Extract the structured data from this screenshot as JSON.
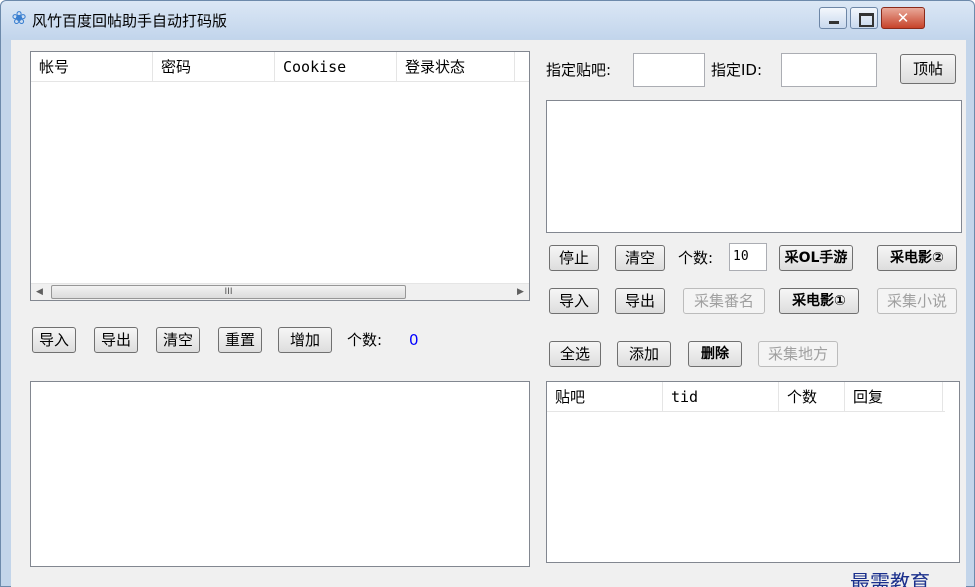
{
  "window": {
    "title": "风竹百度回帖助手自动打码版",
    "icon": "paw-icon",
    "controls": [
      "minimize-icon",
      "maximize-icon",
      "close-icon"
    ]
  },
  "accounts": {
    "columns": [
      "帐号",
      "密码",
      "Cookise",
      "登录状态"
    ],
    "rows": [],
    "scroll_grip": "III",
    "buttons": [
      "导入",
      "导出",
      "清空",
      "重置",
      "增加"
    ],
    "count_label": "个数:",
    "count_value": "0"
  },
  "target": {
    "bar_label": "指定贴吧:",
    "bar_value": "",
    "id_label": "指定ID:",
    "id_value": "",
    "top_button": "顶帖"
  },
  "collect": {
    "row1": {
      "stop": "停止",
      "clear": "清空",
      "count_label": "个数:",
      "count_value": "10",
      "game": "采OL手游",
      "movie2": "采电影②"
    },
    "row2": {
      "import": "导入",
      "export": "导出",
      "drama": "采集番名",
      "movie1": "采电影①",
      "novel": "采集小说"
    },
    "row3": {
      "select_all": "全选",
      "add": "添加",
      "delete": "删除",
      "place": "采集地方"
    },
    "disabled": [
      "采集番名",
      "采集小说",
      "采集地方"
    ]
  },
  "posts": {
    "columns": [
      "贴吧",
      "tid",
      "个数",
      "回复"
    ],
    "rows": []
  },
  "colors": {
    "window_frame": "#c3d5ea",
    "client": "#f0f0f0",
    "close_button": "#c7432a",
    "count_value": "#0000ff",
    "watermark": "#1a2f8c"
  },
  "watermark": "最需教育"
}
